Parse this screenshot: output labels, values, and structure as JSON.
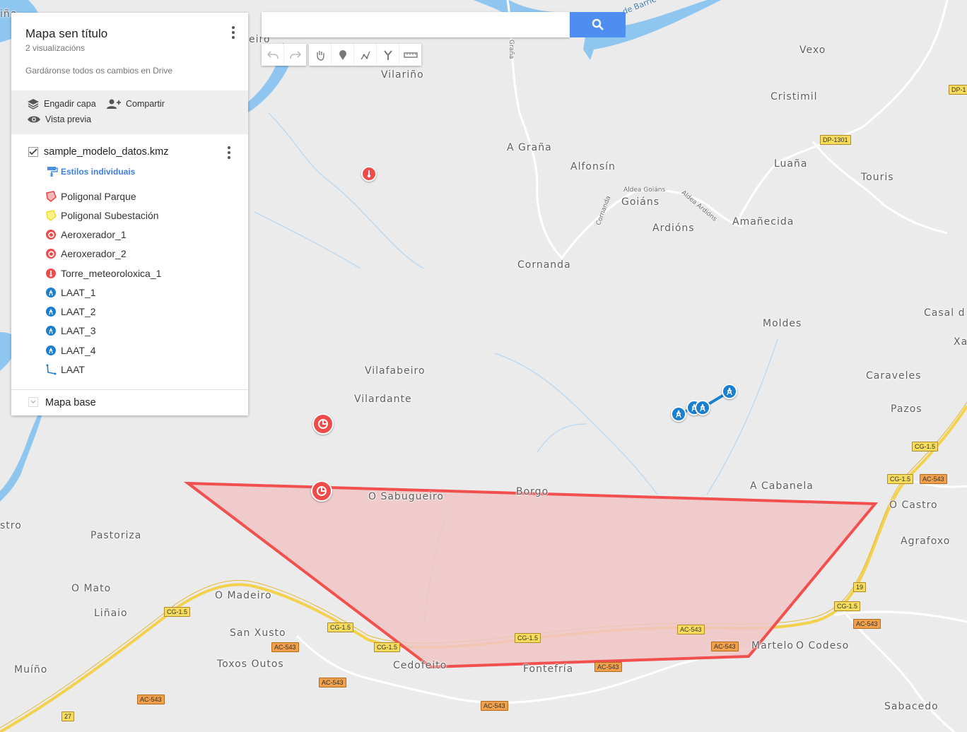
{
  "panel": {
    "title": "Mapa sen título",
    "views": "2 visualizacións",
    "saved": "Gardáronse todos os cambios en Drive",
    "add_layer": "Engadir capa",
    "share": "Compartir",
    "preview": "Vista previa",
    "layer_name": "sample_modelo_datos.kmz",
    "styles_label": "Estilos individuais",
    "items": [
      {
        "label": "Poligonal Parque",
        "icon": "polygon-red-icon"
      },
      {
        "label": "Poligonal Subestación",
        "icon": "polygon-yellow-icon"
      },
      {
        "label": "Aeroxerador_1",
        "icon": "turbine-icon"
      },
      {
        "label": "Aeroxerador_2",
        "icon": "turbine-icon"
      },
      {
        "label": "Torre_meteoroloxica_1",
        "icon": "thermometer-icon"
      },
      {
        "label": "LAAT_1",
        "icon": "pylon-icon"
      },
      {
        "label": "LAAT_2",
        "icon": "pylon-icon"
      },
      {
        "label": "LAAT_3",
        "icon": "pylon-icon"
      },
      {
        "label": "LAAT_4",
        "icon": "pylon-icon"
      },
      {
        "label": "LAAT",
        "icon": "line-icon"
      }
    ],
    "base_map": "Mapa base"
  },
  "search": {
    "placeholder": "",
    "value": ""
  },
  "colors": {
    "polygon_fill": "#f0c6c6",
    "polygon_stroke": "#f24f4f",
    "red_marker": "#f04a4a",
    "blue_marker": "#1b7fcf",
    "search_button": "#4d8ef0"
  },
  "map": {
    "places": [
      "Vexo",
      "Cristimil",
      "Luaña",
      "Touris",
      "Vilariño",
      "A Graña",
      "Alfonsín",
      "Goiáns",
      "Ardións",
      "Amañecida",
      "Cornanda",
      "Moldes",
      "Casal d",
      "Xa",
      "Caraveles",
      "Pazos",
      "Vilafabeiro",
      "Vilardante",
      "O Sabugueiro",
      "Borgo",
      "A Cabanela",
      "O Castro",
      "Agrafoxo",
      "Pastoriza",
      "stro",
      "O Mato",
      "Liñaio",
      "O Madeiro",
      "San Xusto",
      "Toxos Outos",
      "Muíño",
      "Cedofeito",
      "Fontefría",
      "Martelo",
      "O Codeso",
      "Sabacedo",
      "eiro",
      "iño"
    ],
    "road_names": [
      "Embalse de Barrié de la Maza",
      "Graña",
      "Aldea Goiáns",
      "Aldea Ardións",
      "Cornanda"
    ],
    "shields": [
      "DP-1301",
      "DP-1",
      "CG-1.5",
      "CG-1.5",
      "AC-543",
      "CG-1.5",
      "AC-543",
      "19",
      "CG-1.5",
      "AC-543",
      "CG-1.5",
      "CG-1.5",
      "CG-1.5",
      "AC-543",
      "AC-543",
      "AC-543",
      "CG-1.5",
      "AC-543",
      "AC-543",
      "AC-543",
      "27"
    ]
  }
}
